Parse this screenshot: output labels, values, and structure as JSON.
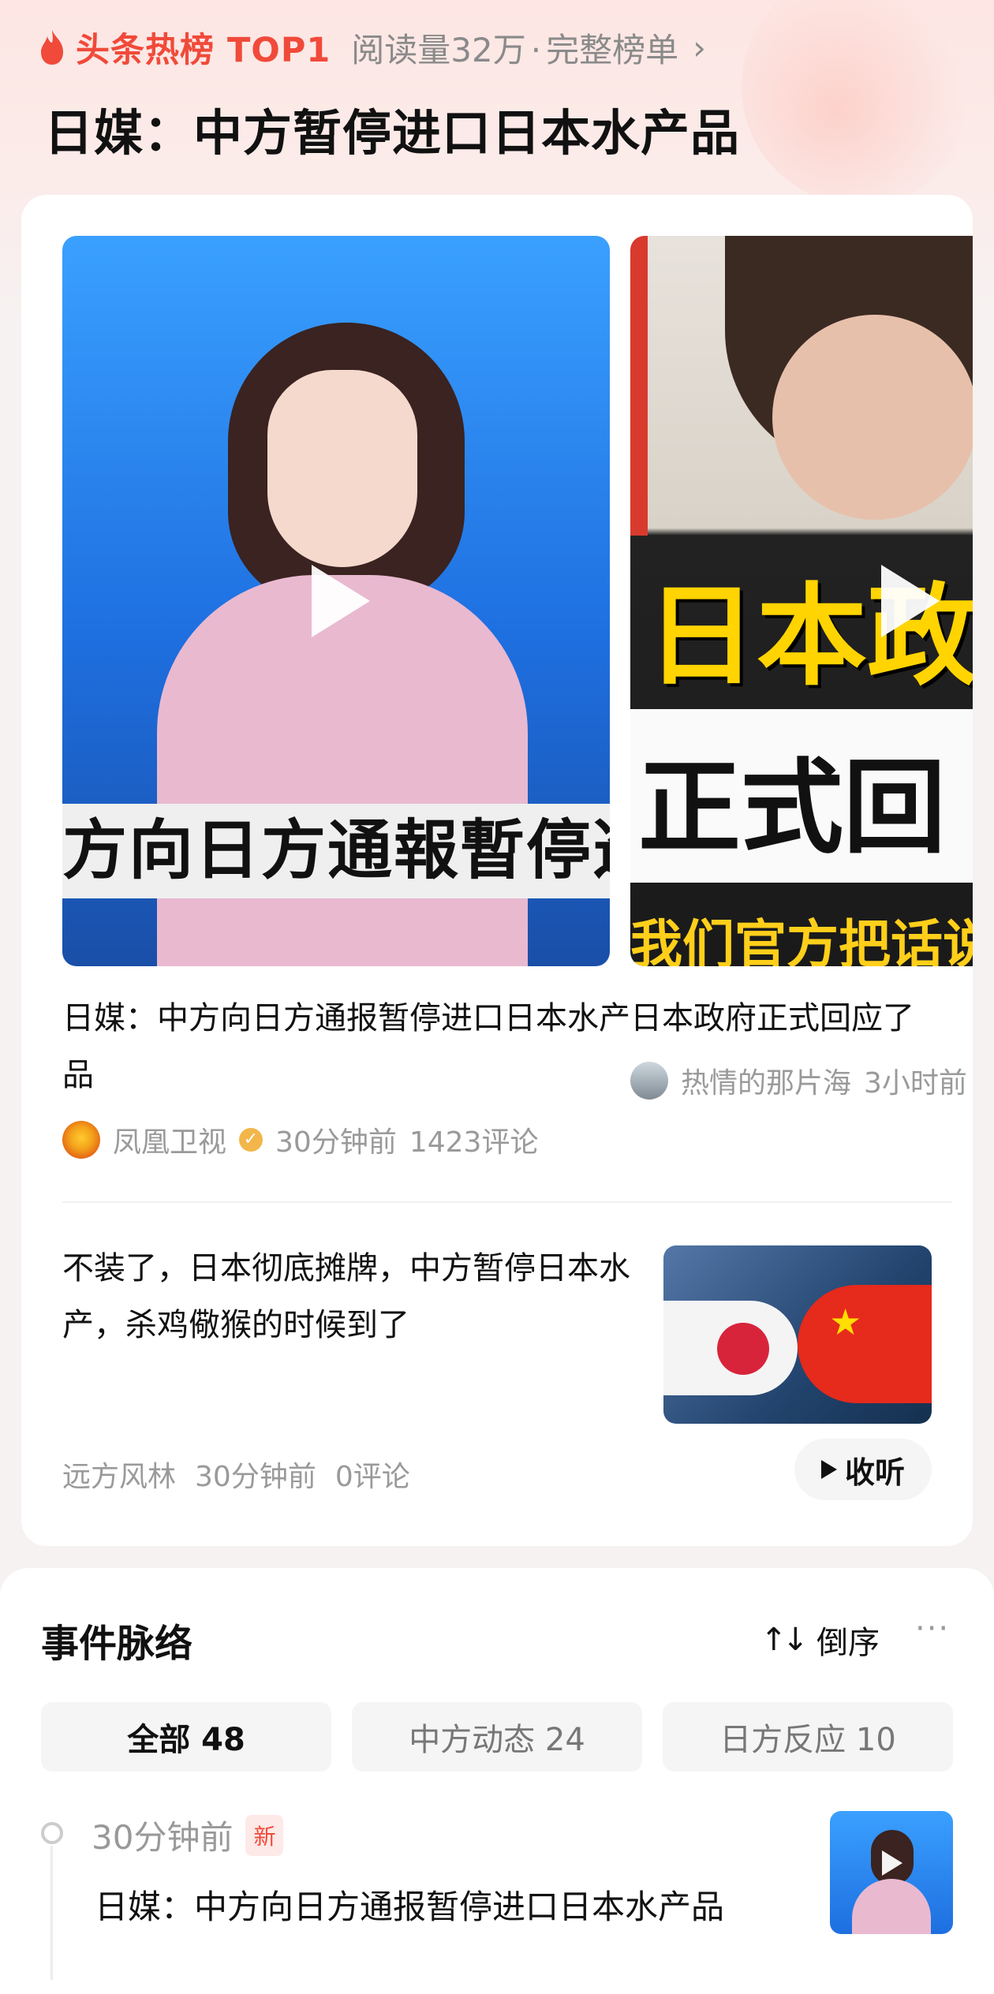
{
  "header": {
    "rank_label": "头条热榜 TOP1",
    "read_count": "阅读量32万",
    "separator": "·",
    "full_list_link": "完整榜单",
    "title": "日媒：中方暂停进口日本水产品"
  },
  "videos": [
    {
      "title": "日媒：中方向日方通报暂停进口日本水产品",
      "overlay_caption": "方向日方通報暫停進口",
      "source": "凤凰卫视",
      "time": "30分钟前",
      "comments": "1423评论"
    },
    {
      "title": "日本政府正式回应了",
      "overlay_text_1": "日本政",
      "overlay_text_2": "正式回",
      "overlay_text_3": "我们官方把话说",
      "source": "热情的那片海",
      "time": "3小时前"
    }
  ],
  "article": {
    "title": "不装了，日本彻底摊牌，中方暂停日本水产，杀鸡儆猴的时候到了",
    "author": "远方风林",
    "time": "30分钟前",
    "comments": "0评论",
    "listen_label": "收听"
  },
  "timeline": {
    "title": "事件脉络",
    "sort_label": "倒序",
    "more": "···",
    "tabs": [
      "全部 48",
      "中方动态 24",
      "日方反应 10"
    ],
    "entry": {
      "time": "30分钟前",
      "badge": "新",
      "text": "日媒：中方向日方通报暂停进口日本水产品"
    }
  },
  "colors": {
    "accent": "#f04a3a",
    "muted": "#9a9a9a"
  }
}
